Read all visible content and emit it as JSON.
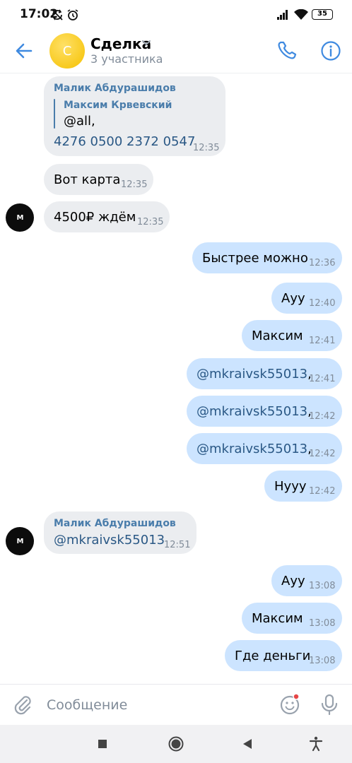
{
  "status_bar": {
    "time": "17:02",
    "battery": "35",
    "icons": [
      "sync-off-icon",
      "alarm-icon",
      "signal-icon",
      "wifi-icon",
      "battery-icon"
    ]
  },
  "header": {
    "avatar_letter": "С",
    "title": "Сделка",
    "subtitle": "3 участника",
    "accent_color": "#3f8ae0",
    "avatar_color": "#f5c100"
  },
  "messages": [
    {
      "direction": "incoming",
      "sender": "Малик Абдурашидов",
      "quote_author": "Максим Крвевский",
      "quote_text": "@all,",
      "text": "4276 0500 2372 0547",
      "time": "12:35"
    },
    {
      "direction": "incoming",
      "text": "Вот карта",
      "time": "12:35"
    },
    {
      "direction": "incoming",
      "text": "4500₽ ждём",
      "time": "12:35",
      "avatar": "M"
    },
    {
      "direction": "outgoing",
      "text": "Быстрее можно",
      "time": "12:36"
    },
    {
      "direction": "outgoing",
      "text": "Ауу",
      "time": "12:40"
    },
    {
      "direction": "outgoing",
      "text": "Максим",
      "time": "12:41"
    },
    {
      "direction": "outgoing",
      "mention": "@mkraivsk55013",
      "suffix": ",",
      "time": "12:41"
    },
    {
      "direction": "outgoing",
      "mention": "@mkraivsk55013",
      "suffix": ",",
      "time": "12:42"
    },
    {
      "direction": "outgoing",
      "mention": "@mkraivsk55013",
      "suffix": ",",
      "time": "12:42"
    },
    {
      "direction": "outgoing",
      "text": "Нууу",
      "time": "12:42"
    },
    {
      "direction": "incoming",
      "sender": "Малик Абдурашидов",
      "mention": "@mkraivsk55013",
      "time": "12:51",
      "avatar": "M"
    },
    {
      "direction": "outgoing",
      "text": "Ауу",
      "time": "13:08"
    },
    {
      "direction": "outgoing",
      "text": "Максим",
      "time": "13:08"
    },
    {
      "direction": "outgoing",
      "text": "Где деньги",
      "time": "13:08"
    }
  ],
  "composer": {
    "placeholder": "Сообщение"
  },
  "colors": {
    "incoming_bubble": "#ebedf0",
    "outgoing_bubble": "#cce4ff",
    "link": "#2a5885",
    "sender_name": "#4a7dab",
    "time": "#818c99",
    "notification_dot": "#e64646"
  }
}
